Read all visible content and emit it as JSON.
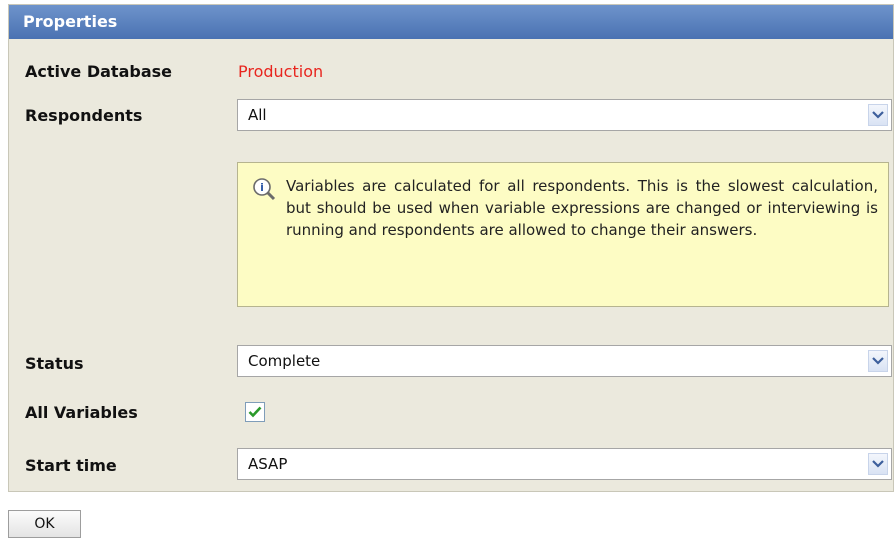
{
  "panel": {
    "title": "Properties"
  },
  "active_database": {
    "label": "Active Database",
    "value": "Production"
  },
  "respondents": {
    "label": "Respondents",
    "selected": "All",
    "icon": "chevron-down-icon"
  },
  "info": {
    "icon": "info-magnifier-icon",
    "text": "Variables are calculated for all respondents. This is the slowest calculation, but should be used when variable expressions are changed or interviewing is running and respondents are allowed to change their answers."
  },
  "status": {
    "label": "Status",
    "selected": "Complete"
  },
  "all_variables": {
    "label": "All Variables",
    "checked": true
  },
  "start_time": {
    "label": "Start time",
    "selected": "ASAP"
  },
  "ok_button": {
    "label": "OK"
  },
  "colors": {
    "title_bar": "#5a80bf",
    "panel_bg": "#ebe9dd",
    "value_red": "#e8261f",
    "info_bg": "#fdfcc4",
    "check_green": "#2a9a2a"
  }
}
